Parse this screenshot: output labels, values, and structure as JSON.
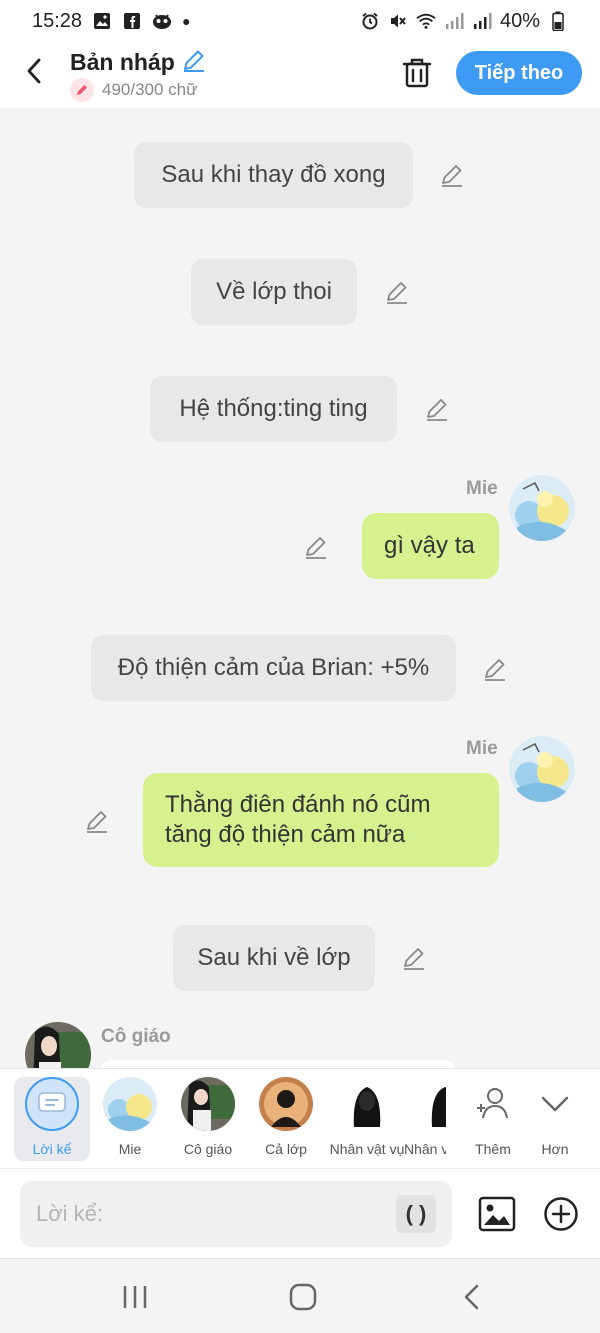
{
  "status_bar": {
    "time": "15:28",
    "battery": "40%"
  },
  "header": {
    "title": "Bản nháp",
    "word_count": "490/300 chữ",
    "next_label": "Tiếp theo"
  },
  "chat": {
    "narrations": [
      "Sau khi thay đồ xong",
      "Về lớp thoi",
      "Hệ thống:ting ting",
      "Độ thiện cảm của Brian: +5%",
      "Sau khi về lớp"
    ],
    "messages": [
      {
        "speaker": "Mie",
        "line1": "gì vậy ta",
        "line2": ""
      },
      {
        "speaker": "Mie",
        "line1": "Thằng điên đánh nó cũm",
        "line2": "tăng độ thiện cảm nữa"
      }
    ],
    "last_speaker": "Cô giáo"
  },
  "characters": [
    {
      "label": "Lời kể"
    },
    {
      "label": "Mie"
    },
    {
      "label": "Cô giáo"
    },
    {
      "label": "Cả lớp"
    },
    {
      "label": "Nhân vật vụ"
    },
    {
      "label": "Nhân v"
    },
    {
      "label": "Thêm"
    },
    {
      "label": "Hơn"
    }
  ],
  "input": {
    "placeholder": "Lời kể:",
    "paren": "( )"
  },
  "colors": {
    "accent": "#3d9bf5",
    "bubble": "#d6f28e",
    "narration_bg": "#e8e8e8"
  }
}
